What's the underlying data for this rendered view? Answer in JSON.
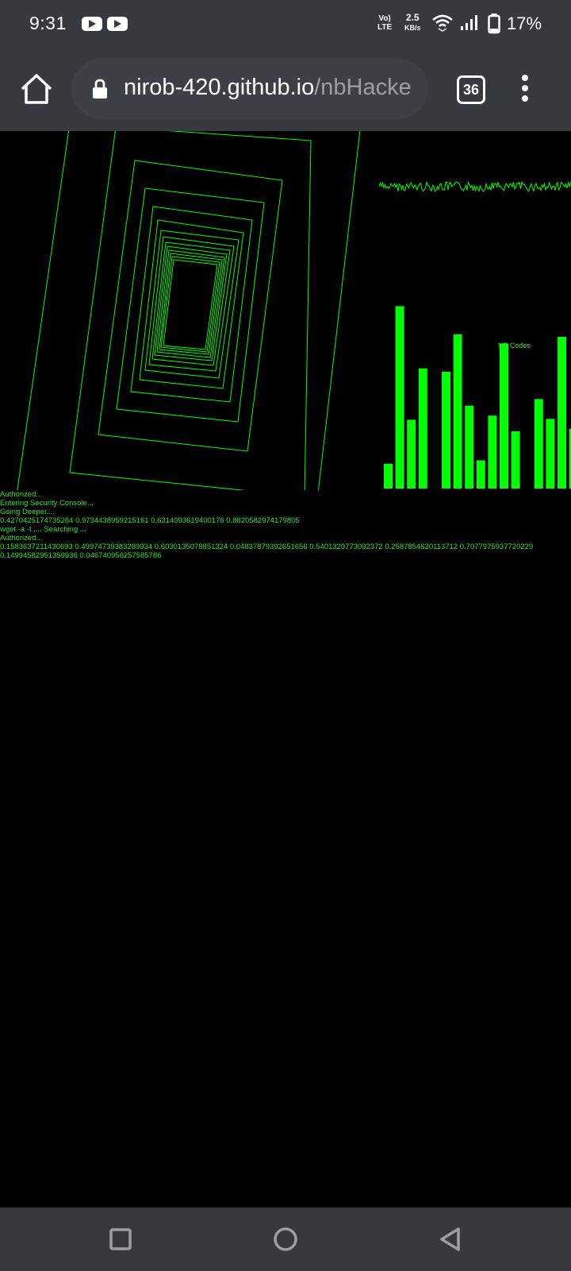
{
  "status_bar": {
    "time": "9:31",
    "volte_top": "Vo) ",
    "volte_bottom": "LTE",
    "net_speed": "2.5",
    "net_speed_unit": "KB/s",
    "battery": "17%",
    "notification_icons": [
      "youtube-icon",
      "youtube-icon"
    ]
  },
  "browser": {
    "url_host": "nirob-420.github.io",
    "url_path": "/nbHacke",
    "tab_count": "36"
  },
  "page": {
    "chart_label": "NB Codes",
    "console_lines": [
      "Authorized...",
      "Entering Security Console...",
      "Going Deeper....",
      "0.4270425174735264 0.9734438959215161 0.6314093619400176 0.8820582974179805",
      "wget -a -t .... Searching ...",
      "Authorized...",
      "0.1583637211430693 0.49974739383289934 0.6030135078851324 0.04837879392651656 0.5401329773092372 0.2587854620113712 0.7077975937720229",
      "0.14994582951359936 0.046740956257585786"
    ],
    "colors": {
      "green": "#00ff00",
      "text_green": "#2ee02e",
      "background": "#000000"
    }
  },
  "chart_data": {
    "type": "bar",
    "title": "NB Codes",
    "values": [
      30,
      220,
      83,
      145,
      0,
      141,
      186,
      100,
      34,
      88,
      175,
      69,
      0,
      108,
      84,
      183,
      72
    ],
    "ylim": [
      0,
      230
    ]
  }
}
